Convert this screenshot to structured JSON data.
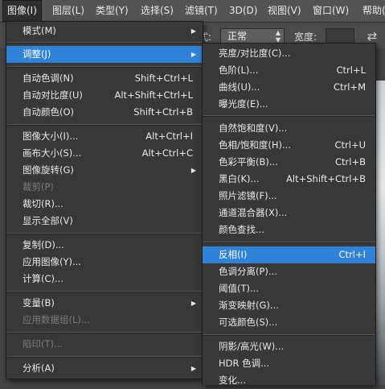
{
  "menubar": [
    {
      "label": "图像(I)",
      "active": true
    },
    {
      "label": "图层(L)"
    },
    {
      "label": "类型(Y)"
    },
    {
      "label": "选择(S)"
    },
    {
      "label": "滤镜(T)"
    },
    {
      "label": "3D(D)"
    },
    {
      "label": "视图(V)"
    },
    {
      "label": "窗口(W)"
    },
    {
      "label": "帮助("
    }
  ],
  "options_bar": {
    "partial_label": "式:",
    "mode_value": "正常",
    "width_label": "宽度:"
  },
  "image_menu": {
    "items": [
      {
        "label": "模式(M)",
        "submenu": true
      },
      {
        "label": "调整(J)",
        "submenu": true,
        "highlighted": true
      },
      {
        "label": "自动色调(N)",
        "shortcut": "Shift+Ctrl+L"
      },
      {
        "label": "自动对比度(U)",
        "shortcut": "Alt+Shift+Ctrl+L"
      },
      {
        "label": "自动颜色(O)",
        "shortcut": "Shift+Ctrl+B"
      },
      {
        "label": "图像大小(I)...",
        "shortcut": "Alt+Ctrl+I"
      },
      {
        "label": "画布大小(S)...",
        "shortcut": "Alt+Ctrl+C"
      },
      {
        "label": "图像旋转(G)",
        "submenu": true
      },
      {
        "label": "裁剪(P)",
        "disabled": true
      },
      {
        "label": "裁切(R)..."
      },
      {
        "label": "显示全部(V)"
      },
      {
        "label": "复制(D)..."
      },
      {
        "label": "应用图像(Y)..."
      },
      {
        "label": "计算(C)..."
      },
      {
        "label": "变量(B)",
        "submenu": true
      },
      {
        "label": "应用数据组(L)...",
        "disabled": true
      },
      {
        "label": "陷印(T)...",
        "disabled": true
      },
      {
        "label": "分析(A)",
        "submenu": true
      }
    ]
  },
  "adjust_menu": {
    "items": [
      {
        "label": "亮度/对比度(C)..."
      },
      {
        "label": "色阶(L)...",
        "shortcut": "Ctrl+L"
      },
      {
        "label": "曲线(U)...",
        "shortcut": "Ctrl+M"
      },
      {
        "label": "曝光度(E)..."
      },
      {
        "label": "自然饱和度(V)..."
      },
      {
        "label": "色相/饱和度(H)...",
        "shortcut": "Ctrl+U"
      },
      {
        "label": "色彩平衡(B)...",
        "shortcut": "Ctrl+B"
      },
      {
        "label": "黑白(K)...",
        "shortcut": "Alt+Shift+Ctrl+B"
      },
      {
        "label": "照片滤镜(F)..."
      },
      {
        "label": "通道混合器(X)..."
      },
      {
        "label": "颜色查找..."
      },
      {
        "label": "反相(I)",
        "shortcut": "Ctrl+I",
        "highlighted": true
      },
      {
        "label": "色调分离(P)..."
      },
      {
        "label": "阈值(T)..."
      },
      {
        "label": "渐变映射(G)..."
      },
      {
        "label": "可选颜色(S)..."
      },
      {
        "label": "阴影/高光(W)..."
      },
      {
        "label": "HDR 色调..."
      },
      {
        "label": "变化..."
      }
    ]
  }
}
